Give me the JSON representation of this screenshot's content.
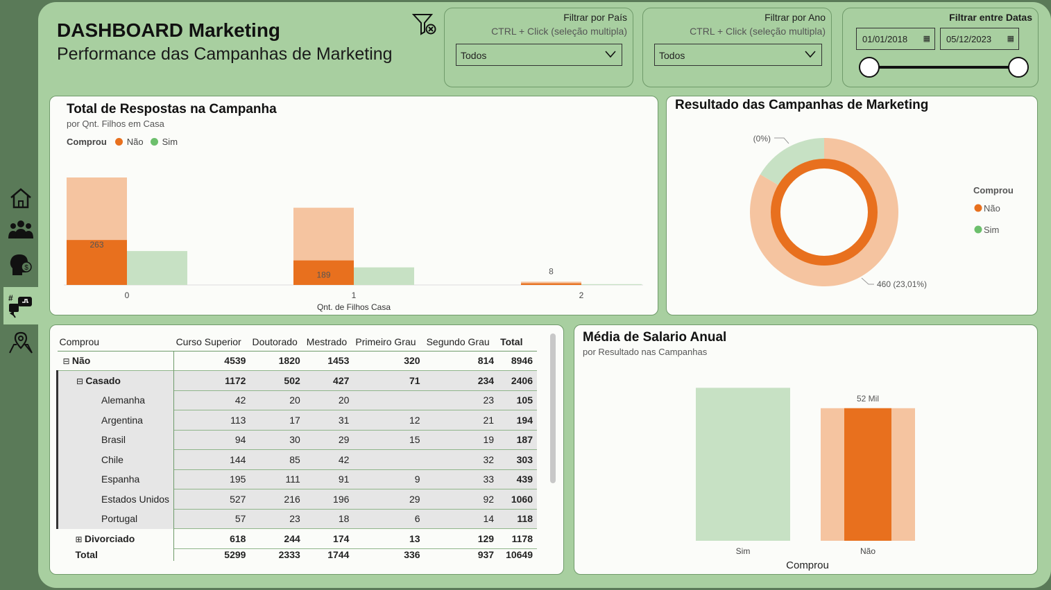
{
  "header": {
    "title": "DASHBOARD Marketing",
    "subtitle": "Performance das Campanhas de Marketing"
  },
  "sidebar": {
    "items": [
      {
        "icon": "home-icon"
      },
      {
        "icon": "people-icon"
      },
      {
        "icon": "head-money-icon"
      },
      {
        "icon": "social-marketing-icon",
        "active": true
      },
      {
        "icon": "map-pin-icon"
      }
    ]
  },
  "filters": {
    "pais": {
      "title": "Filtrar por País",
      "hint": "CTRL + Click (seleção multipla)",
      "value": "Todos"
    },
    "ano": {
      "title": "Filtrar por Ano",
      "hint": "CTRL + Click (seleção multipla)",
      "value": "Todos"
    },
    "datas": {
      "title": "Filtrar entre Datas",
      "start": "01/01/2018",
      "end": "05/12/2023"
    }
  },
  "colors": {
    "nao_dark": "#e8701e",
    "nao_light": "#f5c4a0",
    "sim_light": "#c7e1c4",
    "sim_dot": "#6cbf6c",
    "page_bg": "#a8cfa0"
  },
  "respostas": {
    "title": "Total de Respostas na Campanha",
    "subtitle": "por Qnt. Filhos em Casa",
    "legend_title": "Comprou",
    "legend": [
      "Não",
      "Sim"
    ],
    "xlabel": "Qnt. de Filhos Casa"
  },
  "resultado": {
    "title": "Resultado das Campanhas de Marketing",
    "legend_title": "Comprou",
    "legend": [
      "Não",
      "Sim"
    ],
    "label_sim": "(0%)",
    "label_nao": "460 (23,01%)"
  },
  "salario": {
    "title": "Média de Salario Anual",
    "subtitle": "por Resultado nas Campanhas",
    "xlabel": "Comprou",
    "value_label": "52 Mil"
  },
  "chart_data": [
    {
      "type": "bar",
      "title": "Total de Respostas na Campanha",
      "xlabel": "Qnt. de Filhos Casa",
      "categories": [
        "0",
        "1",
        "2"
      ],
      "series": [
        {
          "name": "Não",
          "values": [
            263,
            189,
            8
          ]
        },
        {
          "name": "Sim",
          "values": [
            83,
            43,
            2
          ]
        }
      ],
      "highlighted_nao": [
        110,
        60,
        4
      ],
      "legend": "top-left"
    },
    {
      "type": "pie",
      "title": "Resultado das Campanhas de Marketing",
      "labels": [
        "Não",
        "Sim"
      ],
      "values": [
        83.5,
        16.5
      ],
      "highlighted": {
        "Não": 460,
        "Sim": 0
      },
      "data_labels": [
        "460 (23,01%)",
        "(0%)"
      ],
      "legend": "right"
    },
    {
      "type": "bar",
      "title": "Média de Salario Anual",
      "xlabel": "Comprou",
      "categories": [
        "Sim",
        "Não"
      ],
      "values": [
        60,
        52
      ],
      "highlighted_nao": 52,
      "data_labels": [
        "",
        "52 Mil"
      ],
      "ylim": [
        0,
        62
      ]
    }
  ],
  "matrix": {
    "columns": [
      "Comprou",
      "Curso Superior",
      "Doutorado",
      "Mestrado",
      "Primeiro Grau",
      "Segundo Grau",
      "Total"
    ],
    "rows": [
      {
        "label": "Não",
        "level": 0,
        "bold": true,
        "expand": "⊟",
        "values": [
          "4539",
          "1820",
          "1453",
          "320",
          "814",
          "8946"
        ]
      },
      {
        "label": "Casado",
        "level": 1,
        "bold": true,
        "expand": "⊟",
        "shaded": true,
        "values": [
          "1172",
          "502",
          "427",
          "71",
          "234",
          "2406"
        ]
      },
      {
        "label": "Alemanha",
        "level": 2,
        "shaded": true,
        "values": [
          "42",
          "20",
          "20",
          "",
          "23",
          "105"
        ]
      },
      {
        "label": "Argentina",
        "level": 2,
        "shaded": true,
        "values": [
          "113",
          "17",
          "31",
          "12",
          "21",
          "194"
        ]
      },
      {
        "label": "Brasil",
        "level": 2,
        "shaded": true,
        "values": [
          "94",
          "30",
          "29",
          "15",
          "19",
          "187"
        ]
      },
      {
        "label": "Chile",
        "level": 2,
        "shaded": true,
        "values": [
          "144",
          "85",
          "42",
          "",
          "32",
          "303"
        ]
      },
      {
        "label": "Espanha",
        "level": 2,
        "shaded": true,
        "values": [
          "195",
          "111",
          "91",
          "9",
          "33",
          "439"
        ]
      },
      {
        "label": "Estados Unidos",
        "level": 2,
        "shaded": true,
        "values": [
          "527",
          "216",
          "196",
          "29",
          "92",
          "1060"
        ]
      },
      {
        "label": "Portugal",
        "level": 2,
        "shaded": true,
        "values": [
          "57",
          "23",
          "18",
          "6",
          "14",
          "118"
        ]
      },
      {
        "label": "Divorciado",
        "level": 1,
        "bold": true,
        "expand": "⊞",
        "values": [
          "618",
          "244",
          "174",
          "13",
          "129",
          "1178"
        ]
      }
    ],
    "total": {
      "label": "Total",
      "values": [
        "5299",
        "2333",
        "1744",
        "336",
        "937",
        "10649"
      ]
    }
  }
}
